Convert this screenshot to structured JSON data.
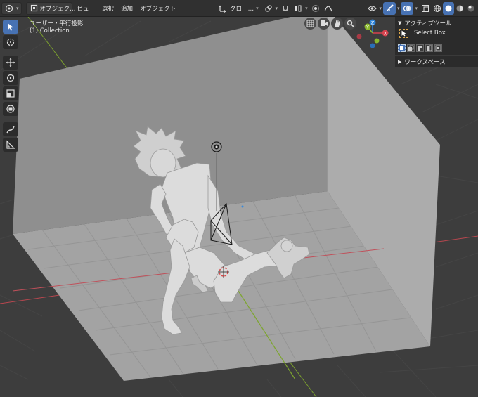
{
  "header": {
    "mode_label": "オブジェク…",
    "menu": [
      "ビュー",
      "選択",
      "追加",
      "オブジェクト"
    ],
    "transform_orientation": "グロー…"
  },
  "viewport": {
    "view_name": "ユーザー・平行投影",
    "collection": "(1) Collection"
  },
  "gizmo": {
    "x": "X",
    "y": "Y",
    "z": "Z"
  },
  "side_panel": {
    "active_tool_header": "アクティブツール",
    "tool_name": "Select Box",
    "workspace_header": "ワークスペース"
  },
  "colors": {
    "accent": "#4772b3",
    "x_axis": "#d6424e",
    "y_axis": "#8ab82e",
    "z_axis": "#2e83d8"
  }
}
